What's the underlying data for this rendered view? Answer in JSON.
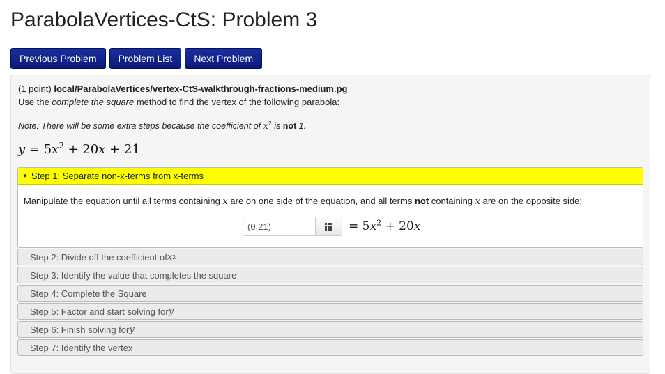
{
  "page": {
    "title": "ParabolaVertices-CtS: Problem 3"
  },
  "nav": {
    "previous": "Previous Problem",
    "list": "Problem List",
    "next": "Next Problem"
  },
  "problem": {
    "points": "(1 point)",
    "path": "local/ParabolaVertices/vertex-CtS-walkthrough-fractions-medium.pg",
    "instruction_pre": "Use the ",
    "instruction_em": "complete the square",
    "instruction_post": " method to find the vertex of the following parabola:",
    "note_pre": "Note: There will be some extra steps because the coefficient of ",
    "note_var": "x",
    "note_exp": "2",
    "note_mid": " is ",
    "note_bold": "not",
    "note_post": " 1.",
    "equation": {
      "lhs": "y",
      "eq": " = 5",
      "x1": "x",
      "exp": "2",
      "mid": " + 20",
      "x2": "x",
      "tail": " + 21"
    }
  },
  "steps": {
    "open": {
      "label": "Step 1: Separate non-x-terms from x-terms",
      "body_pre": "Manipulate the equation until all terms containing ",
      "body_var1": "x",
      "body_mid": " are on one side of the equation, and all terms ",
      "body_bold": "not",
      "body_mid2": " containing ",
      "body_var2": "x",
      "body_post": " are on the opposite side:",
      "answer_value": "(0,21)",
      "rhs": {
        "eq": "= 5",
        "x1": "x",
        "exp": "2",
        "mid": " + 20",
        "x2": "x"
      }
    },
    "step2": {
      "text": "Step 2: Divide off the coefficient of ",
      "var": "x",
      "exp": "2"
    },
    "step3": {
      "text": "Step 3: Identify the value that completes the square"
    },
    "step4": {
      "text": "Step 4: Complete the Square"
    },
    "step5": {
      "text": "Step 5: Factor and start solving for ",
      "var": "y"
    },
    "step6": {
      "text": "Step 6: Finish solving for ",
      "var": "y"
    },
    "step7": {
      "text": "Step 7: Identify the vertex"
    }
  },
  "icons": {
    "step_toggle": "triangle-down-icon",
    "palette": "grid-icon"
  },
  "colors": {
    "nav_button": "#0c1a7a",
    "open_step_header": "#ffff00",
    "closed_step_bg": "#ebebeb"
  }
}
